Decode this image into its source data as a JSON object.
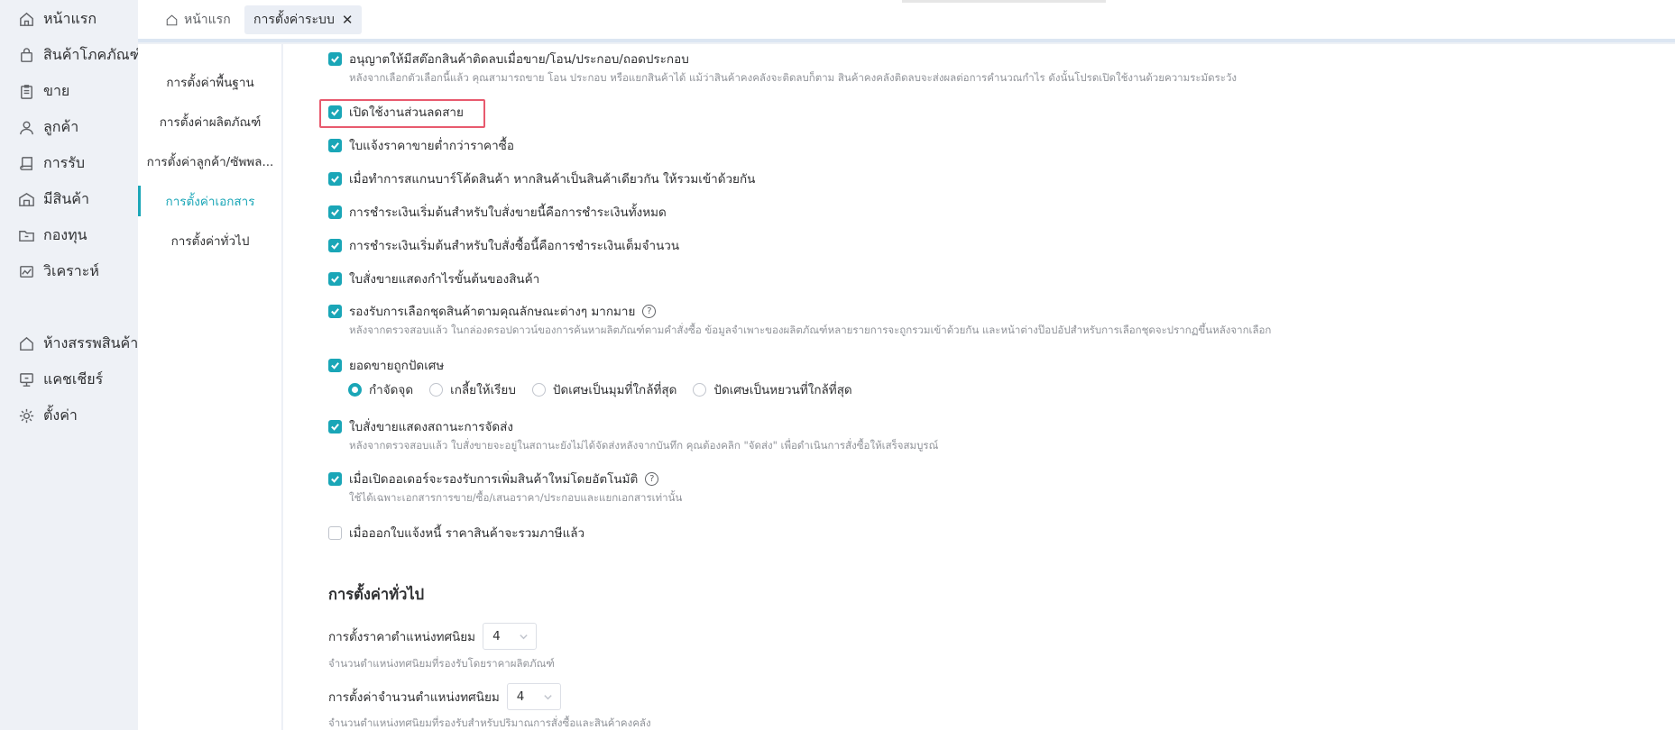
{
  "nav": {
    "items": [
      {
        "label": "หน้าแรก",
        "icon": "home-icon"
      },
      {
        "label": "สินค้าโภคภัณฑ์",
        "icon": "bag-icon"
      },
      {
        "label": "ขาย",
        "icon": "clipboard-icon"
      },
      {
        "label": "ลูกค้า",
        "icon": "user-icon"
      },
      {
        "label": "การรับ",
        "icon": "book-icon"
      },
      {
        "label": "มีสินค้า",
        "icon": "warehouse-icon"
      },
      {
        "label": "กองทุน",
        "icon": "folder-icon"
      },
      {
        "label": "วิเคราะห์",
        "icon": "chart-icon"
      },
      {
        "label": "ห้างสรรพสินค้า",
        "icon": "store-icon"
      },
      {
        "label": "แคชเชียร์",
        "icon": "monitor-icon"
      },
      {
        "label": "ตั้งค่า",
        "icon": "gear-icon"
      }
    ]
  },
  "tabs": [
    {
      "label": "หน้าแรก",
      "active": false
    },
    {
      "label": "การตั้งค่าระบบ",
      "active": true,
      "close": "✕"
    }
  ],
  "submenu": {
    "items": [
      "การตั้งค่าพื้นฐาน",
      "การตั้งค่าผลิตภัณฑ์",
      "การตั้งค่าลูกค้า/ซัพพล...",
      "การตั้งค่าเอกสาร",
      "การตั้งค่าทั่วไป"
    ],
    "active_index": 3
  },
  "options": [
    {
      "label": "อนุญาตให้มีสต๊อกสินค้าติดลบเมื่อขาย/โอน/ประกอบ/ถอดประกอบ",
      "checked": true,
      "hint": "หลังจากเลือกตัวเลือกนี้แล้ว คุณสามารถขาย โอน ประกอบ หรือแยกสินค้าได้ แม้ว่าสินค้าคงคลังจะติดลบก็ตาม สินค้าคงคลังติดลบจะส่งผลต่อการคำนวณกำไร ดังนั้นโปรดเปิดใช้งานด้วยความระมัดระวัง"
    },
    {
      "label": "เปิดใช้งานส่วนลดสาย",
      "checked": true
    },
    {
      "label": "ใบแจ้งราคาขายต่ำกว่าราคาซื้อ",
      "checked": true
    },
    {
      "label": "เมื่อทำการสแกนบาร์โค้ดสินค้า หากสินค้าเป็นสินค้าเดียวกัน ให้รวมเข้าด้วยกัน",
      "checked": true
    },
    {
      "label": "การชำระเงินเริ่มต้นสำหรับใบสั่งขายนี้คือการชำระเงินทั้งหมด",
      "checked": true
    },
    {
      "label": "การชำระเงินเริ่มต้นสำหรับใบสั่งซื้อนี้คือการชำระเงินเต็มจำนวน",
      "checked": true
    },
    {
      "label": "ใบสั่งขายแสดงกำไรขั้นต้นของสินค้า",
      "checked": true
    },
    {
      "label": "รองรับการเลือกชุดสินค้าตามคุณลักษณะต่างๆ มากมาย",
      "checked": true,
      "help": "?",
      "hint": "หลังจากตรวจสอบแล้ว ในกล่องดรอปดาวน์ของการค้นหาผลิตภัณฑ์ตามคำสั่งซื้อ ข้อมูลจำเพาะของผลิตภัณฑ์หลายรายการจะถูกรวมเข้าด้วยกัน และหน้าต่างป๊อปอัปสำหรับการเลือกชุดจะปรากฏขึ้นหลังจากเลือก"
    },
    {
      "label": "ยอดขายถูกปัดเศษ",
      "checked": true
    },
    {
      "label": "ใบสั่งขายแสดงสถานะการจัดส่ง",
      "checked": true,
      "hint": "หลังจากตรวจสอบแล้ว ใบสั่งขายจะอยู่ในสถานะยังไม่ได้จัดส่งหลังจากบันทึก คุณต้องคลิก \"จัดส่ง\" เพื่อดำเนินการสั่งซื้อให้เสร็จสมบูรณ์"
    },
    {
      "label": "เมื่อเปิดออเดอร์จะรองรับการเพิ่มสินค้าใหม่โดยอัตโนมัติ",
      "checked": true,
      "help": "?",
      "hint": "ใช้ได้เฉพาะเอกสารการขาย/ซื้อ/เสนอราคา/ประกอบและแยกเอกสารเท่านั้น"
    },
    {
      "label": "เมื่อออกใบแจ้งหนี้ ราคาสินค้าจะรวมภาษีแล้ว",
      "checked": false
    }
  ],
  "rounding": {
    "options": [
      "กำจัดจุด",
      "เกลี้ยให้เรียบ",
      "ปัดเศษเป็นมุมที่ใกล้ที่สุด",
      "ปัดเศษเป็นหยวนที่ใกล้ที่สุด"
    ],
    "selected_index": 0
  },
  "general": {
    "title": "การตั้งค่าทั่วไป",
    "fields": [
      {
        "label": "การตั้งราคาตำแหน่งทศนิยม",
        "value": "4",
        "hint": "จำนวนตำแหน่งทศนิยมที่รองรับโดยราคาผลิตภัณฑ์"
      },
      {
        "label": "การตั้งค่าจำนวนตำแหน่งทศนิยม",
        "value": "4",
        "hint": "จำนวนตำแหน่งทศนิยมที่รองรับสำหรับปริมาณการสั่งซื้อและสินค้าคงคลัง"
      }
    ]
  },
  "colors": {
    "accent": "#1aa6b7",
    "highlight": "#e85a6e"
  }
}
